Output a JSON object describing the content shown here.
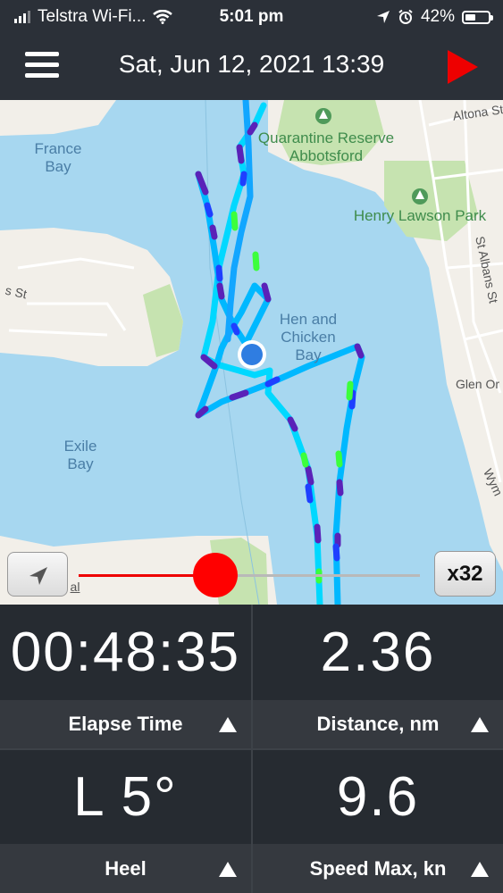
{
  "status_bar": {
    "carrier": "Telstra Wi-Fi...",
    "time": "5:01 pm",
    "battery": "42%"
  },
  "header": {
    "title": "Sat, Jun 12, 2021 13:39"
  },
  "map": {
    "labels": {
      "france_bay": "France\nBay",
      "exile_bay": "Exile\nBay",
      "hen_chicken_bay": "Hen and\nChicken\nBay",
      "quarantine_reserve": "Quarantine Reserve\nAbbotsford",
      "henry_lawson_park": "Henry Lawson Park",
      "altona_st": "Altona St",
      "st_albans_st": "St Albans St",
      "glen_orchard": "Glen Or",
      "wym": "Wym",
      "ss_st": "s St",
      "al": "al"
    },
    "colors": {
      "water": "#a7d7f0",
      "land": "#f2efe9",
      "park": "#c6e3b0",
      "track_fast": "#00e0ff",
      "track_mid": "#1f3fff",
      "track_slow": "#5a22b8",
      "track_peak": "#3cff3c",
      "position_dot": "#2f7de1"
    }
  },
  "playback": {
    "speed_label": "x32",
    "progress": 0.4
  },
  "stats": [
    {
      "value": "00:48:35",
      "label": "Elapse Time"
    },
    {
      "value": "2.36",
      "label": "Distance, nm"
    },
    {
      "value": "L 5°",
      "label": "Heel"
    },
    {
      "value": "9.6",
      "label": "Speed Max, kn"
    }
  ]
}
